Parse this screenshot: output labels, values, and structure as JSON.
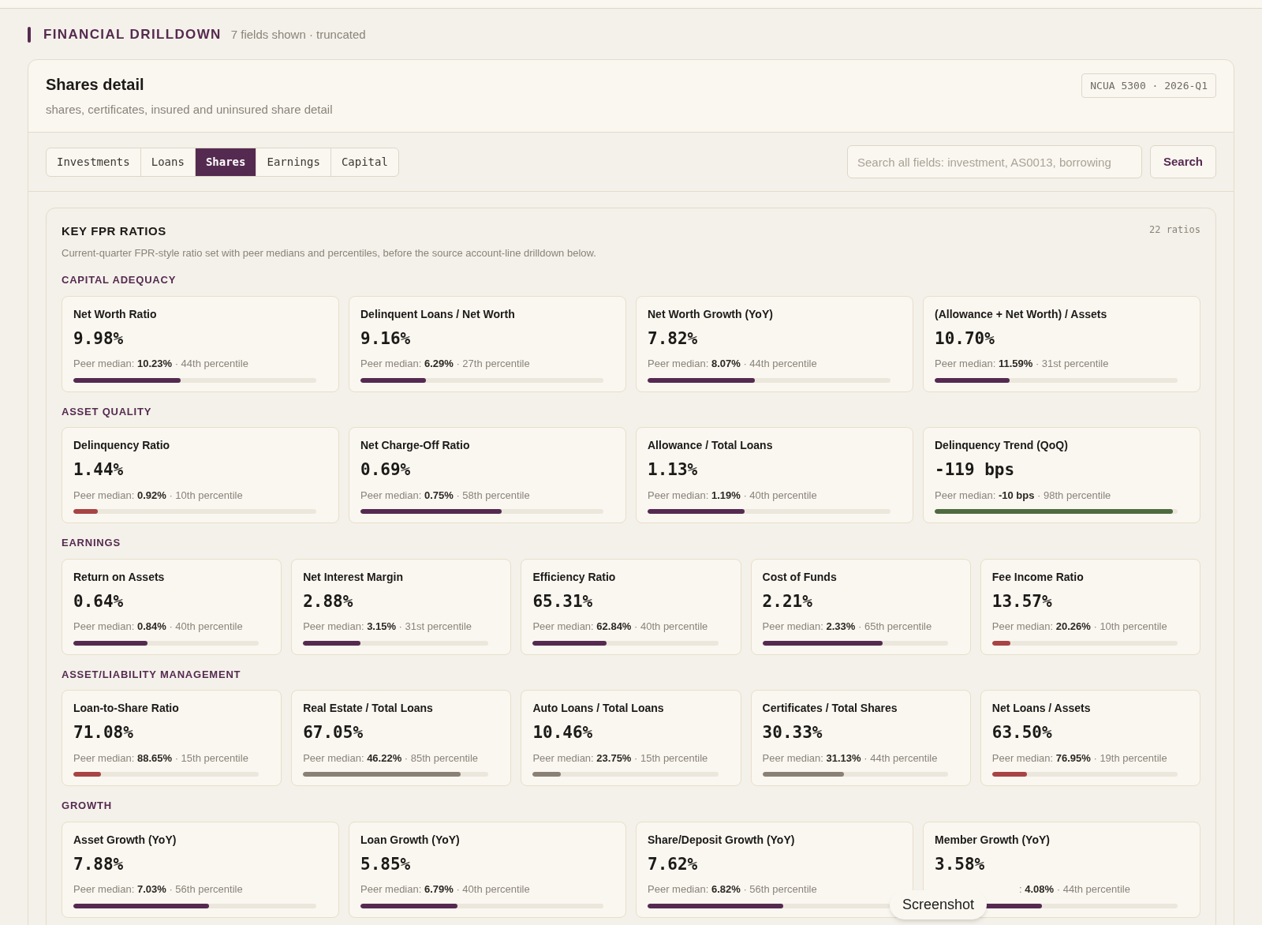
{
  "header": {
    "title": "FINANCIAL DRILLDOWN",
    "meta": "7 fields shown · truncated"
  },
  "detail": {
    "title": "Shares detail",
    "subtitle": "shares, certificates, insured and uninsured share detail",
    "badge": "NCUA 5300 · 2026-Q1"
  },
  "tabs": [
    {
      "label": "Investments",
      "selected": false
    },
    {
      "label": "Loans",
      "selected": false
    },
    {
      "label": "Shares",
      "selected": true
    },
    {
      "label": "Earnings",
      "selected": false
    },
    {
      "label": "Capital",
      "selected": false
    }
  ],
  "search": {
    "placeholder": "Search all fields: investment, AS0013, borrowing",
    "button": "Search"
  },
  "ratios": {
    "title": "KEY FPR RATIOS",
    "count": "22 ratios",
    "description": "Current-quarter FPR-style ratio set with peer medians and percentiles, before the source account-line drilldown below.",
    "groups": [
      {
        "name": "CAPITAL ADEQUACY",
        "cards": [
          {
            "title": "Net Worth Ratio",
            "value": "9.98%",
            "note": "Peer median: **10.23%** · 44th percentile",
            "level": 0.44,
            "color": "#552a50"
          },
          {
            "title": "Delinquent Loans / Net Worth",
            "value": "9.16%",
            "note": "Peer median: **6.29%** · 27th percentile",
            "level": 0.27,
            "color": "#552a50"
          },
          {
            "title": "Net Worth Growth (YoY)",
            "value": "7.82%",
            "note": "Peer median: **8.07%** · 44th percentile",
            "level": 0.44,
            "color": "#552a50"
          },
          {
            "title": "(Allowance + Net Worth) / Assets",
            "value": "10.70%",
            "note": "Peer median: **11.59%** · 31st percentile",
            "level": 0.31,
            "color": "#552a50"
          }
        ]
      },
      {
        "name": "ASSET QUALITY",
        "cards": [
          {
            "title": "Delinquency Ratio",
            "value": "1.44%",
            "note": "Peer median: **0.92%** · 10th percentile",
            "level": 0.1,
            "color": "#a84444"
          },
          {
            "title": "Net Charge-Off Ratio",
            "value": "0.69%",
            "note": "Peer median: **0.75%** · 58th percentile",
            "level": 0.58,
            "color": "#552a50"
          },
          {
            "title": "Allowance / Total Loans",
            "value": "1.13%",
            "note": "Peer median: **1.19%** · 40th percentile",
            "level": 0.4,
            "color": "#552a50"
          },
          {
            "title": "Delinquency Trend (QoQ)",
            "value": "-119 bps",
            "note": "Peer median: **-10 bps** · 98th percentile",
            "level": 0.98,
            "color": "#4e6b3f"
          }
        ]
      },
      {
        "name": "EARNINGS",
        "cards": [
          {
            "title": "Return on Assets",
            "value": "0.64%",
            "note": "Peer median: **0.84%** · 40th percentile",
            "level": 0.4,
            "color": "#552a50"
          },
          {
            "title": "Net Interest Margin",
            "value": "2.88%",
            "note": "Peer median: **3.15%** · 31st percentile",
            "level": 0.31,
            "color": "#552a50"
          },
          {
            "title": "Efficiency Ratio",
            "value": "65.31%",
            "note": "Peer median: **62.84%** · 40th percentile",
            "level": 0.4,
            "color": "#552a50"
          },
          {
            "title": "Cost of Funds",
            "value": "2.21%",
            "note": "Peer median: **2.33%** · 65th percentile",
            "level": 0.65,
            "color": "#552a50"
          },
          {
            "title": "Fee Income Ratio",
            "value": "13.57%",
            "note": "Peer median: **20.26%** · 10th percentile",
            "level": 0.1,
            "color": "#a84444"
          }
        ]
      },
      {
        "name": "ASSET/LIABILITY MANAGEMENT",
        "cards": [
          {
            "title": "Loan-to-Share Ratio",
            "value": "71.08%",
            "note": "Peer median: **88.65%** · 15th percentile",
            "level": 0.15,
            "color": "#a84444"
          },
          {
            "title": "Real Estate / Total Loans",
            "value": "67.05%",
            "note": "Peer median: **46.22%** · 85th percentile",
            "level": 0.85,
            "color": "#8a8174"
          },
          {
            "title": "Auto Loans / Total Loans",
            "value": "10.46%",
            "note": "Peer median: **23.75%** · 15th percentile",
            "level": 0.15,
            "color": "#8a8174"
          },
          {
            "title": "Certificates / Total Shares",
            "value": "30.33%",
            "note": "Peer median: **31.13%** · 44th percentile",
            "level": 0.44,
            "color": "#8a8174"
          },
          {
            "title": "Net Loans / Assets",
            "value": "63.50%",
            "note": "Peer median: **76.95%** · 19th percentile",
            "level": 0.19,
            "color": "#a84444"
          }
        ]
      },
      {
        "name": "GROWTH",
        "cards": [
          {
            "title": "Asset Growth (YoY)",
            "value": "7.88%",
            "note": "Peer median: **7.03%** · 56th percentile",
            "level": 0.56,
            "color": "#552a50"
          },
          {
            "title": "Loan Growth (YoY)",
            "value": "5.85%",
            "note": "Peer median: **6.79%** · 40th percentile",
            "level": 0.4,
            "color": "#552a50"
          },
          {
            "title": "Share/Deposit Growth (YoY)",
            "value": "7.62%",
            "note": "Peer median: **6.82%** · 56th percentile",
            "level": 0.56,
            "color": "#552a50"
          },
          {
            "title": "Member Growth (YoY)",
            "value": "3.58%",
            "note": ": **4.08%** · 44th percentile",
            "level": 0.44,
            "color": "#552a50",
            "covered": true
          }
        ]
      }
    ]
  },
  "tooltip": {
    "label": "Screenshot"
  }
}
